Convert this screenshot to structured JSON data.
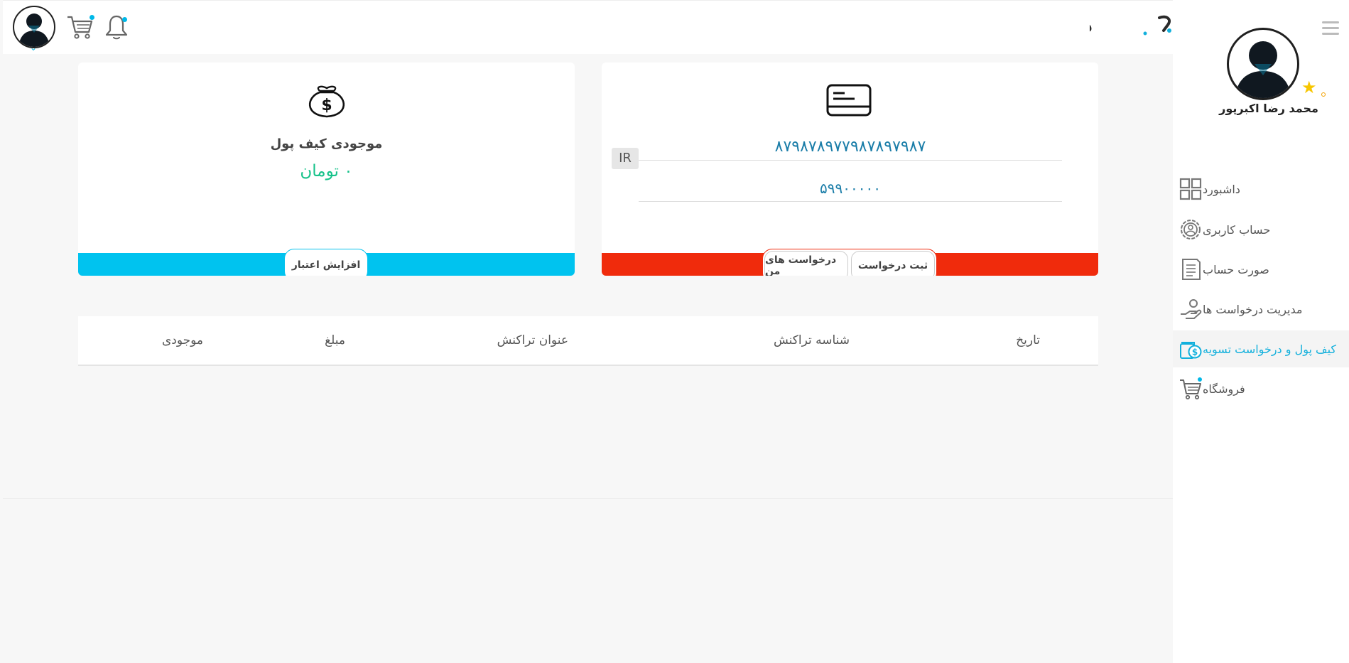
{
  "header": {
    "logo_text": "دیجی‌یار",
    "icons": [
      "user-avatar",
      "cart-icon",
      "bell-icon"
    ]
  },
  "sidebar": {
    "profile_name": "محمد رضا اکبرپور",
    "items": [
      {
        "label": "داشبورد",
        "icon": "dashboard-icon"
      },
      {
        "label": "حساب کاربری",
        "icon": "user-settings-icon"
      },
      {
        "label": "صورت حساب",
        "icon": "invoice-icon"
      },
      {
        "label": "مدیریت درخواست ها",
        "icon": "hand-request-icon"
      },
      {
        "label": "کیف پول و درخواست تسویه",
        "icon": "wallet-icon",
        "active": true
      },
      {
        "label": "فروشگاه",
        "icon": "cart-icon"
      }
    ]
  },
  "wallet_card": {
    "title": "موجودی کیف پول",
    "amount": "۰ تومان",
    "credit_button": "افزایش اعتبار",
    "bar_color": "#00c3ef"
  },
  "bank_card": {
    "iban": "۸۷۹۸۷۸۹۷۷۹۸۷۸۹۷۹۸۷",
    "iban_prefix": "IR",
    "card_number": "۵۹۹۰۰۰۰۰",
    "my_requests_button": "درخواست های من",
    "submit_request_button": "ثبت درخواست",
    "bar_color": "#f02b0c"
  },
  "transactions_table": {
    "headers": [
      "تاریخ",
      "شناسه تراکنش",
      "عنوان تراکنش",
      "مبلغ",
      "موجودی"
    ]
  },
  "colors": {
    "accent": "#12b0dc",
    "amount_green": "#16c28a",
    "iban_blue": "#1a7da8"
  }
}
